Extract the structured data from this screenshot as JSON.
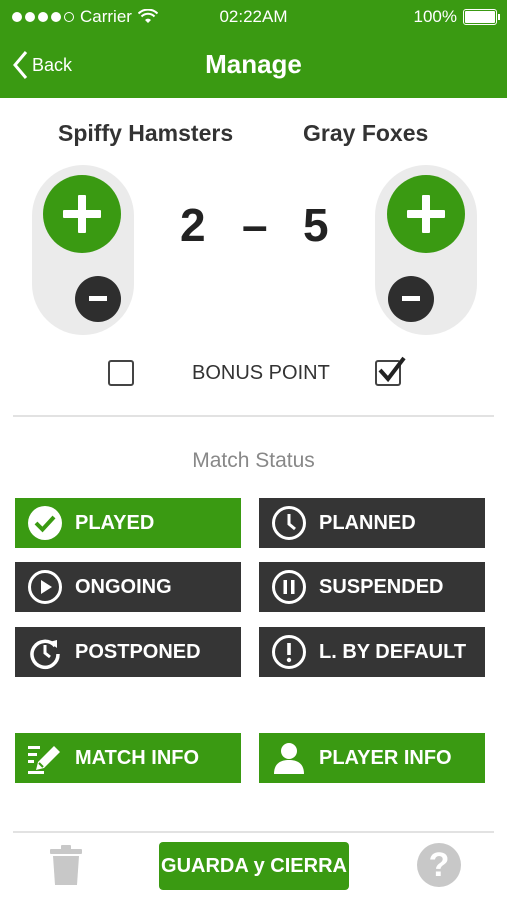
{
  "status_bar": {
    "carrier": "Carrier",
    "time": "02:22AM",
    "battery": "100%"
  },
  "nav": {
    "back_label": "Back",
    "title": "Manage"
  },
  "match": {
    "home_team": "Spiffy Hamsters",
    "away_team": "Gray Foxes",
    "home_score": "2",
    "separator": "–",
    "away_score": "5",
    "bonus_label": "BONUS POINT",
    "home_bonus_checked": false,
    "away_bonus_checked": true
  },
  "status_section": {
    "title": "Match Status",
    "buttons": [
      {
        "label": "PLAYED",
        "icon": "check-circle-icon",
        "selected": true
      },
      {
        "label": "PLANNED",
        "icon": "clock-icon",
        "selected": false
      },
      {
        "label": "ONGOING",
        "icon": "play-circle-icon",
        "selected": false
      },
      {
        "label": "SUSPENDED",
        "icon": "pause-circle-icon",
        "selected": false
      },
      {
        "label": "POSTPONED",
        "icon": "postpone-icon",
        "selected": false
      },
      {
        "label": "L. BY DEFAULT",
        "icon": "exclamation-circle-icon",
        "selected": false
      }
    ]
  },
  "info": {
    "match_info": "MATCH INFO",
    "player_info": "PLAYER INFO"
  },
  "footer": {
    "save_label": "GUARDA y CIERRA",
    "help_label": "?"
  },
  "colors": {
    "primary_green": "#3a9a12",
    "dark_button": "#353535",
    "pill_gray": "#ebebeb"
  }
}
